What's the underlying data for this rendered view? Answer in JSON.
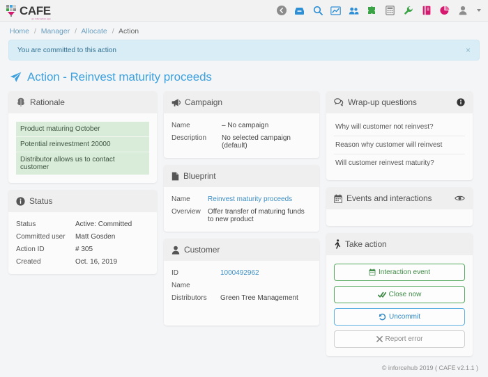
{
  "brand": {
    "name": "CAFE",
    "tagline": "an inforcehub app",
    "logo_icon": "cafe-logo-icon"
  },
  "topnav": {
    "items": [
      {
        "name": "back-icon",
        "label": "Back",
        "color": "#8c8c8c"
      },
      {
        "name": "inbox-icon",
        "label": "Inbox",
        "color": "#2f8fd4"
      },
      {
        "name": "search-icon",
        "label": "Search",
        "color": "#2f8fd4"
      },
      {
        "name": "chart-line-icon",
        "label": "Analytics",
        "color": "#2f8fd4"
      },
      {
        "name": "users-icon",
        "label": "Users",
        "color": "#2f8fd4"
      },
      {
        "name": "puzzle-icon",
        "label": "Plugins",
        "color": "#3aa346"
      },
      {
        "name": "calculator-icon",
        "label": "Calculator",
        "color": "#8c8c8c"
      },
      {
        "name": "wrench-icon",
        "label": "Tools",
        "color": "#3aa346"
      },
      {
        "name": "book-icon",
        "label": "Library",
        "color": "#d6186f"
      },
      {
        "name": "pie-chart-icon",
        "label": "Reports",
        "color": "#d6186f"
      },
      {
        "name": "user-icon",
        "label": "Account",
        "color": "#8c8c8c"
      }
    ]
  },
  "breadcrumb": {
    "items": [
      "Home",
      "Manager",
      "Allocate",
      "Action"
    ],
    "separator": "/"
  },
  "alert": {
    "message": "You are committed to this action",
    "close_label": "×",
    "color": "#d9edf7"
  },
  "page": {
    "title": "Action - Reinvest maturity proceeds",
    "title_icon": "paper-plane-icon",
    "accent": "#3ea1dd"
  },
  "rationale": {
    "heading": "Rationale",
    "icon": "brain-icon",
    "items": [
      "Product maturing October",
      "Potential reinvestment 20000",
      "Distributor allows us to contact customer"
    ],
    "item_color": "#d8ecd9"
  },
  "status": {
    "heading": "Status",
    "icon": "info-circle-icon",
    "rows": [
      {
        "label": "Status",
        "value": "Active: Committed"
      },
      {
        "label": "Committed user",
        "value": "Matt Gosden"
      },
      {
        "label": "Action ID",
        "value": "# 305"
      },
      {
        "label": "Created",
        "value": "Oct. 16, 2019"
      }
    ]
  },
  "campaign": {
    "heading": "Campaign",
    "icon": "bullhorn-icon",
    "rows": [
      {
        "label": "Name",
        "value": "– No campaign"
      },
      {
        "label": "Description",
        "value": "No selected campaign (default)"
      }
    ]
  },
  "blueprint": {
    "heading": "Blueprint",
    "icon": "file-icon",
    "rows": [
      {
        "label": "Name",
        "value": "Reinvest maturity proceeds",
        "link": true
      },
      {
        "label": "Overview",
        "value": "Offer transfer of maturing funds to new product",
        "link": false
      }
    ]
  },
  "customer": {
    "heading": "Customer",
    "icon": "user-icon",
    "rows": [
      {
        "label": "ID",
        "value": "1000492962",
        "link": true
      },
      {
        "label": "Name",
        "value": "",
        "link": false
      },
      {
        "label": "Distributors",
        "value": "Green Tree Management",
        "link": false
      }
    ]
  },
  "wrapup": {
    "heading": "Wrap-up questions",
    "icon": "comments-icon",
    "action_icon": "info-circle-icon",
    "questions": [
      "Why will customer not reinvest?",
      "Reason why customer will reinvest",
      "Will customer reinvest maturity?"
    ]
  },
  "events": {
    "heading": "Events and interactions",
    "icon": "calendar-icon",
    "action_icon": "eye-icon"
  },
  "take_action": {
    "heading": "Take action",
    "icon": "walking-icon",
    "buttons": [
      {
        "label": "Interaction event",
        "icon": "calendar-icon",
        "style": "green"
      },
      {
        "label": "Close now",
        "icon": "check-double-icon",
        "style": "green"
      },
      {
        "label": "Uncommit",
        "icon": "undo-icon",
        "style": "blue"
      },
      {
        "label": "Report error",
        "icon": "times-icon",
        "style": "muted"
      }
    ]
  },
  "footer": {
    "text": "© inforcehub 2019 ( CAFE v2.1.1 )"
  }
}
